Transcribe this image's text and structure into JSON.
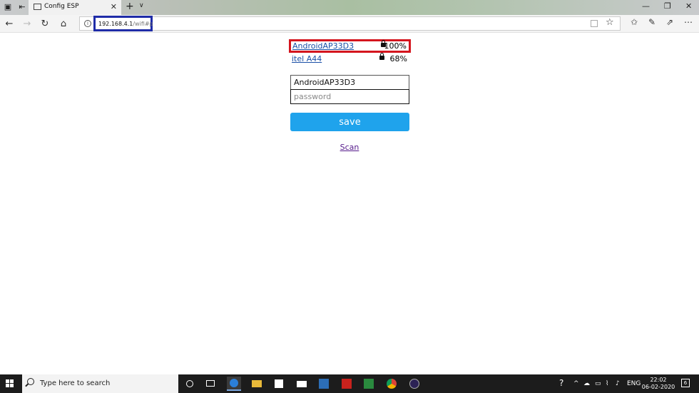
{
  "browser": {
    "tab_title": "Config ESP",
    "url_host": "192.168.4.1",
    "url_path": "/wifi#p",
    "tab_close": "✕",
    "new_tab": "+",
    "tab_dropdown": "∨",
    "window_controls": {
      "minimize": "—",
      "restore": "❐",
      "close": "✕"
    }
  },
  "networks": [
    {
      "name": "AndroidAP33D3",
      "quality": "100%",
      "secured": true,
      "selected": true
    },
    {
      "name": "itel A44",
      "quality": "68%",
      "secured": true,
      "selected": false
    }
  ],
  "form": {
    "ssid_value": "AndroidAP33D3",
    "password_placeholder": "password",
    "save_label": "save",
    "scan_label": "Scan"
  },
  "taskbar": {
    "search_placeholder": "Type here to search",
    "language": "ENG",
    "time": "22:02",
    "date": "06-02-2020",
    "notification_count": "6"
  },
  "colors": {
    "selection_highlight": "#d4151e",
    "url_highlight": "#1f2ca8",
    "save_button": "#1fa3ec",
    "link": "#1a4fa6"
  },
  "icons": {
    "back": "arrow-left-icon",
    "forward": "arrow-right-icon",
    "refresh": "refresh-icon",
    "home": "home-icon",
    "favorites": "star-icon",
    "lock": "lock-icon"
  }
}
